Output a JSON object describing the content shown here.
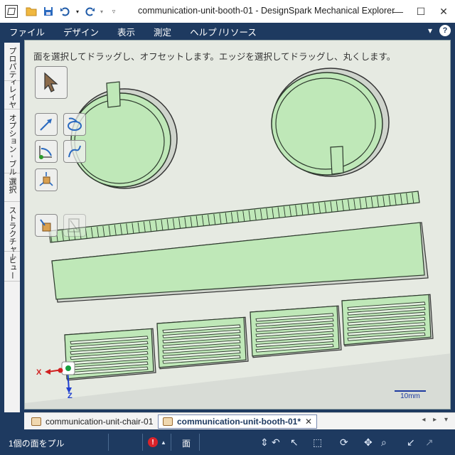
{
  "window": {
    "title": "communication-unit-booth-01 - DesignSpark Mechanical Explorer",
    "controls": {
      "minimize": "—",
      "maximize": "☐",
      "close": "✕"
    }
  },
  "quick_access": {
    "icons": [
      "app-icon",
      "folder-open-icon",
      "save-icon",
      "undo-icon",
      "redo-icon",
      "customize-icon"
    ]
  },
  "menu": {
    "items": [
      "ファイル",
      "デザイン",
      "表示",
      "測定",
      "ヘルプ /リソース"
    ],
    "help_label": "?",
    "collapse_label": "▾"
  },
  "side_tabs": [
    "プロパティ",
    "レイヤ",
    "オプション - ブル",
    "選択",
    "ストラクチャー",
    "ビュー"
  ],
  "viewport": {
    "hint": "面を選択してドラッグし、オフセットします。エッジを選択してドラッグし、丸くします。",
    "scale_label": "10mm",
    "triad": {
      "x_label": "X",
      "z_label": "Z"
    },
    "part_color": "#bfe8b8",
    "selection_color": "#8fd08f",
    "tools": [
      "select-arrow-tool",
      "pull-tool",
      "revolve-tool",
      "sweep-tool",
      "blend-tool",
      "move-tool",
      "fill-tool",
      "pivot-tool"
    ]
  },
  "doc_tabs": [
    {
      "label": "communication-unit-chair-01",
      "active": false
    },
    {
      "label": "communication-unit-booth-01*",
      "active": true,
      "close": "✕"
    }
  ],
  "doc_tab_nav": "◂ ▸ ▾",
  "status": {
    "message": "1個の面をプル",
    "error_count": "!",
    "selection_filter": "面"
  }
}
